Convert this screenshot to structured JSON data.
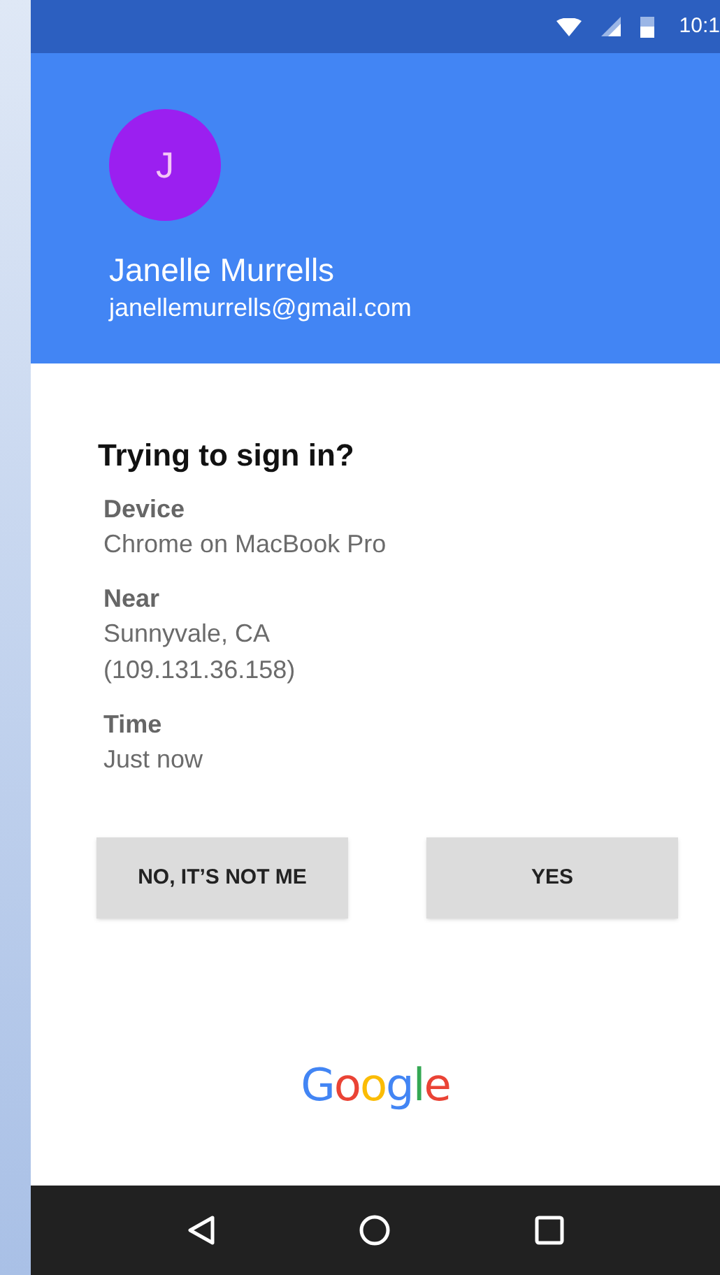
{
  "status_bar": {
    "time": "10:1"
  },
  "account": {
    "initial": "J",
    "name": "Janelle Murrells",
    "email": "janellemurrells@gmail.com"
  },
  "prompt": {
    "title": "Trying to sign in?",
    "details": [
      {
        "label": "Device",
        "lines": [
          "Chrome on MacBook Pro"
        ]
      },
      {
        "label": "Near",
        "lines": [
          "Sunnyvale, CA",
          "(109.131.36.158)"
        ]
      },
      {
        "label": "Time",
        "lines": [
          "Just now"
        ]
      }
    ]
  },
  "buttons": [
    "NO, IT’S NOT ME",
    "YES"
  ],
  "logo": "Google"
}
